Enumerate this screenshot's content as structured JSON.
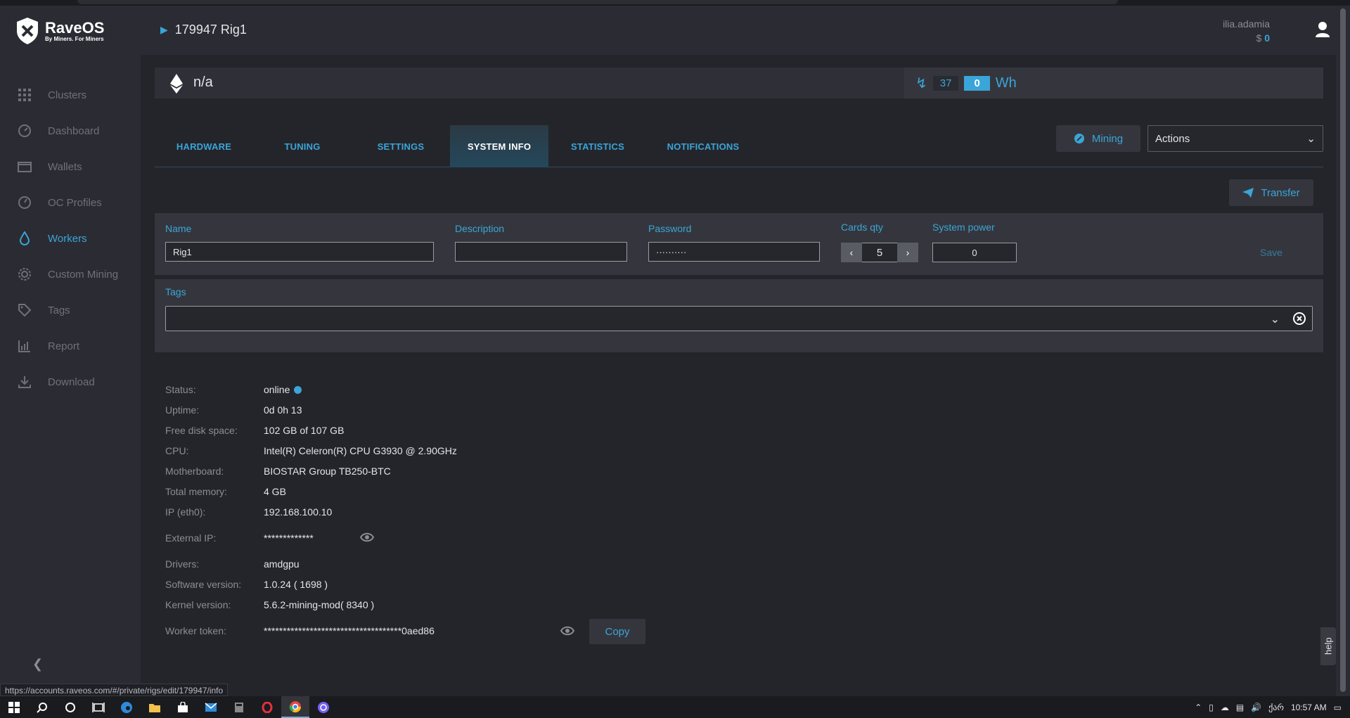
{
  "app": {
    "brand": "RaveOS",
    "tagline": "By Miners. For Miners"
  },
  "sidebar": {
    "items": [
      {
        "label": "Clusters",
        "icon": "grid-icon",
        "active": false
      },
      {
        "label": "Dashboard",
        "icon": "dashboard-gauge-icon",
        "active": false
      },
      {
        "label": "Wallets",
        "icon": "wallet-icon",
        "active": false
      },
      {
        "label": "OC Profiles",
        "icon": "speedometer-icon",
        "active": false
      },
      {
        "label": "Workers",
        "icon": "drop-icon",
        "active": true
      },
      {
        "label": "Custom Mining",
        "icon": "gear-icon",
        "active": false
      },
      {
        "label": "Tags",
        "icon": "tag-icon",
        "active": false
      },
      {
        "label": "Report",
        "icon": "report-chart-icon",
        "active": false
      },
      {
        "label": "Download",
        "icon": "download-icon",
        "active": false
      }
    ]
  },
  "header": {
    "rig_title": "179947 Rig1",
    "user": "ilia.adamia",
    "balance_currency": "$",
    "balance_value": "0"
  },
  "coinbar": {
    "coin": "n/a",
    "power_a": "37",
    "power_b": "0",
    "power_unit": "Wh"
  },
  "tabs": [
    {
      "label": "HARDWARE",
      "active": false
    },
    {
      "label": "TUNING",
      "active": false
    },
    {
      "label": "SETTINGS",
      "active": false
    },
    {
      "label": "SYSTEM INFO",
      "active": true
    },
    {
      "label": "STATISTICS",
      "active": false
    },
    {
      "label": "NOTIFICATIONS",
      "active": false
    }
  ],
  "toolbar": {
    "mining_label": "Mining",
    "actions_label": "Actions",
    "transfer_label": "Transfer"
  },
  "form": {
    "name_label": "Name",
    "name_value": "Rig1",
    "description_label": "Description",
    "description_value": "",
    "password_label": "Password",
    "password_value": "··········",
    "cards_label": "Cards qty",
    "cards_value": "5",
    "power_label": "System power",
    "power_value": "0",
    "save_label": "Save"
  },
  "tags": {
    "label": "Tags"
  },
  "info": {
    "status_k": "Status:",
    "status_v": "online",
    "uptime_k": "Uptime:",
    "uptime_v": "0d 0h 13",
    "disk_k": "Free disk space:",
    "disk_v": "102 GB of 107 GB",
    "cpu_k": "CPU:",
    "cpu_v": "Intel(R) Celeron(R) CPU G3930 @ 2.90GHz",
    "mb_k": "Motherboard:",
    "mb_v": "BIOSTAR Group TB250-BTC",
    "mem_k": "Total memory:",
    "mem_v": "4 GB",
    "ip_k": "IP (eth0):",
    "ip_v": "192.168.100.10",
    "extip_k": "External IP:",
    "extip_v": "*************",
    "drivers_k": "Drivers:",
    "drivers_v": "amdgpu",
    "sw_k": "Software version:",
    "sw_v": "1.0.24 ( 1698 )",
    "kernel_k": "Kernel version:",
    "kernel_v": "5.6.2-mining-mod( 8340 )",
    "token_k": "Worker token:",
    "token_v": "************************************0aed86",
    "copy_label": "Copy"
  },
  "help_label": "help",
  "status_url": "https://accounts.raveos.com/#/private/rigs/edit/179947/info",
  "taskbar": {
    "time": "10:57 AM",
    "lang": "ქარ"
  },
  "colors": {
    "accent": "#3aa5d8",
    "sidebar_bg": "#2b2c33",
    "page_bg": "#24252b"
  }
}
